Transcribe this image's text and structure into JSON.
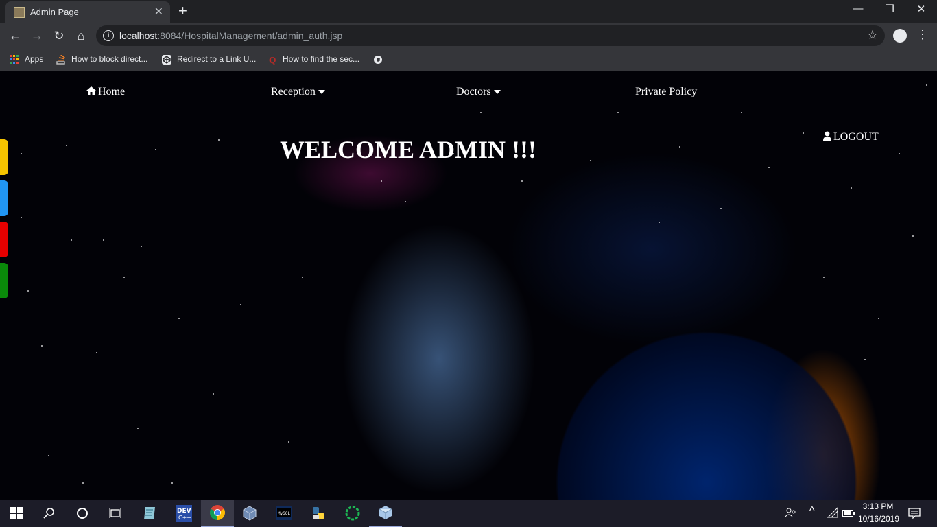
{
  "browser": {
    "tab_title": "Admin Page",
    "url_host": "localhost",
    "url_rest": ":8084/HospitalManagement/admin_auth.jsp",
    "bookmarks": [
      {
        "label": "Apps",
        "icon": "apps-grid-icon"
      },
      {
        "label": "How to block direct...",
        "icon": "stackoverflow-icon"
      },
      {
        "label": "Redirect to a Link U...",
        "icon": "codepen-icon"
      },
      {
        "label": "How to find the sec...",
        "icon": "quora-icon"
      },
      {
        "label": "",
        "icon": "globe-icon"
      }
    ]
  },
  "nav": {
    "home": "Home",
    "reception": "Reception",
    "doctors": "Doctors",
    "policy": "Private Policy"
  },
  "main": {
    "welcome": "WELCOME ADMIN !!!",
    "logout": "LOGOUT"
  },
  "side_tabs": [
    "#f5c400",
    "#2196f3",
    "#e60000",
    "#0a8a0a"
  ],
  "taskbar": {
    "time": "3:13 PM",
    "date": "10/16/2019",
    "apps": [
      "start-icon",
      "search-icon",
      "cortana-icon",
      "task-view-icon",
      "notepad-icon",
      "dev-cpp-icon",
      "chrome-icon",
      "virtualbox-icon",
      "terminal-icon",
      "python-icon",
      "spinner-icon",
      "cube-icon"
    ]
  }
}
